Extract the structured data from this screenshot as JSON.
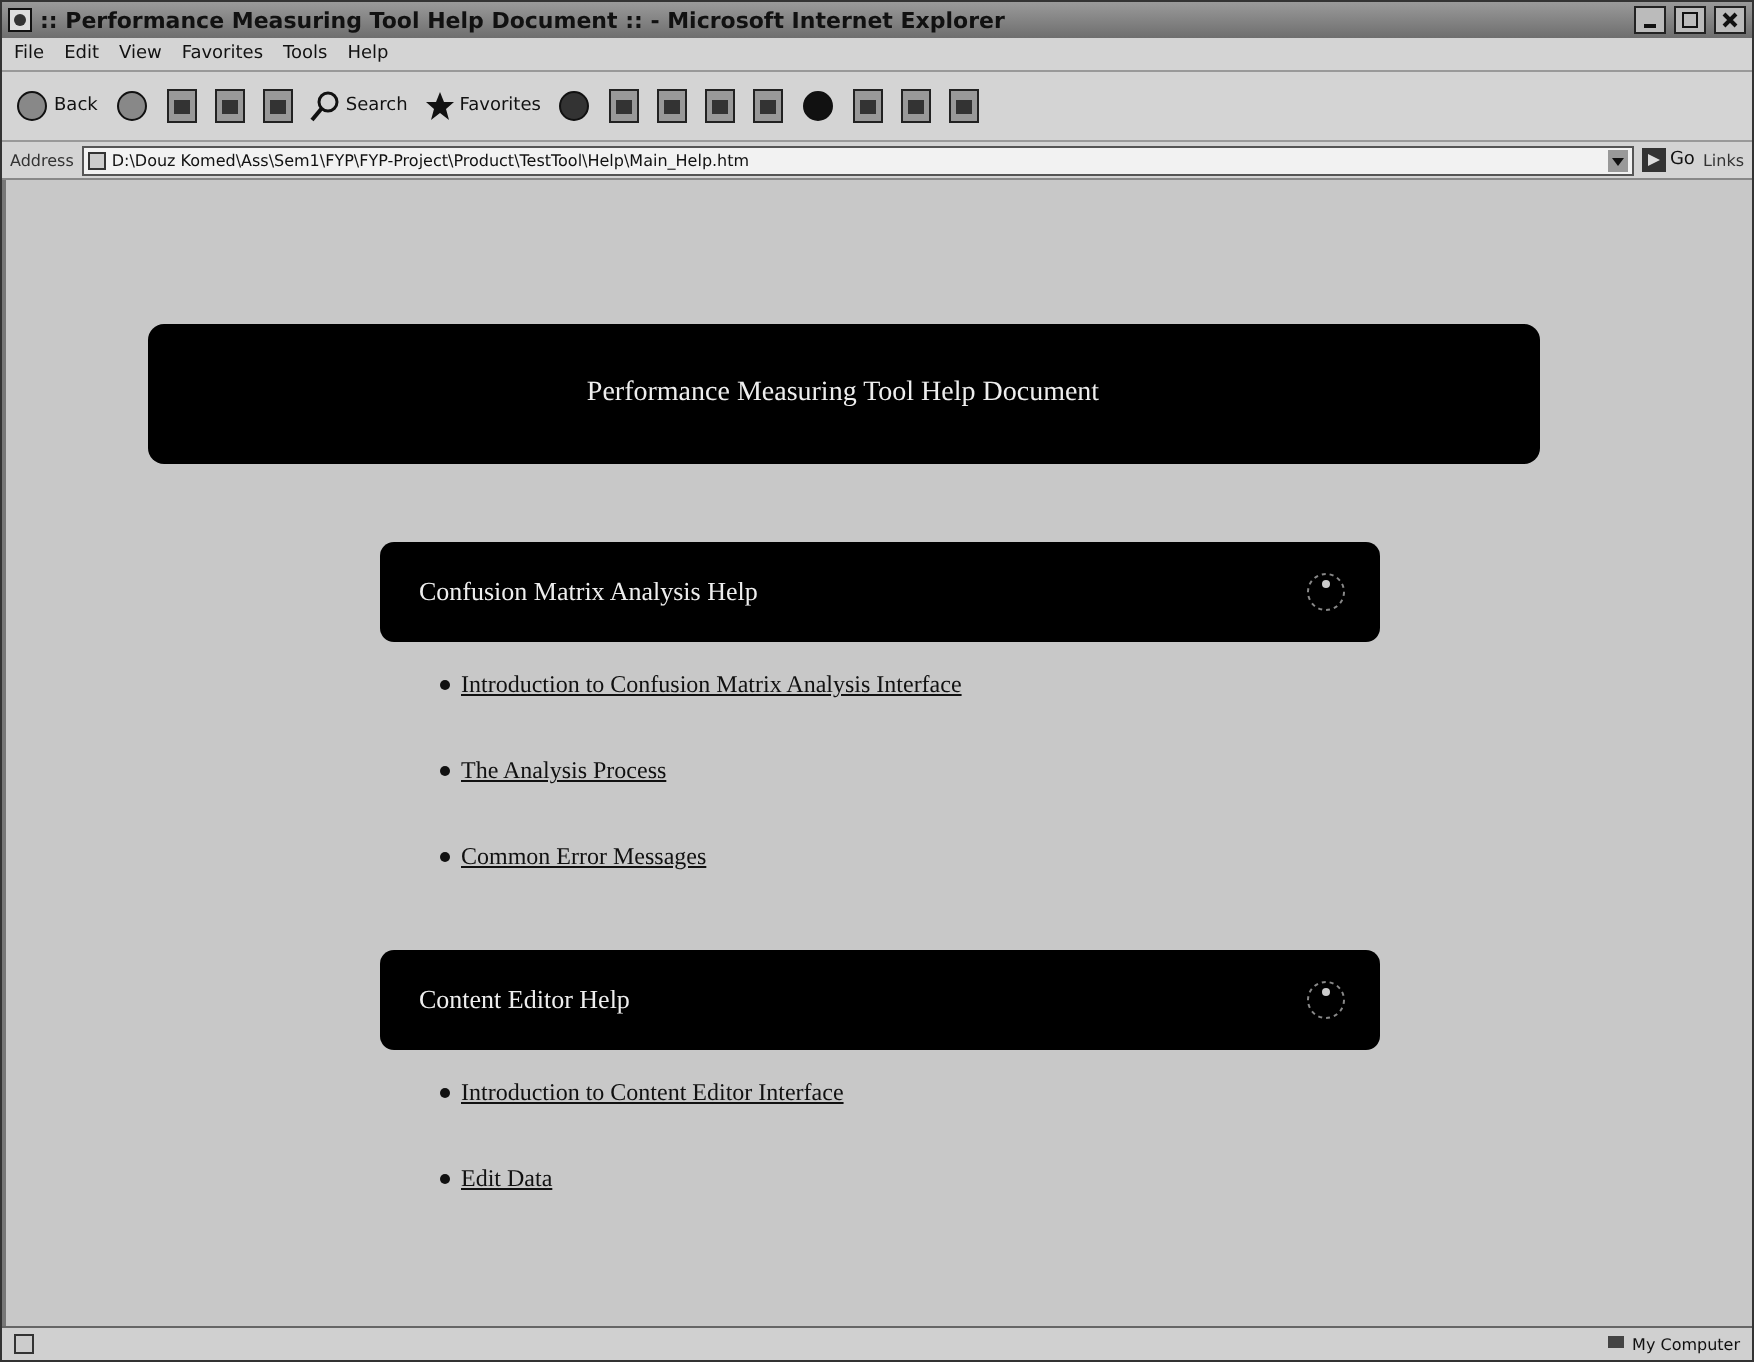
{
  "window": {
    "title": ":: Performance Measuring Tool Help Document :: - Microsoft Internet Explorer"
  },
  "menu": [
    "File",
    "Edit",
    "View",
    "Favorites",
    "Tools",
    "Help"
  ],
  "toolbar": {
    "back": "Back",
    "search": "Search",
    "favorites": "Favorites"
  },
  "address": {
    "label": "Address",
    "value": "D:\\Douz Komed\\Ass\\Sem1\\FYP\\FYP-Project\\Product\\TestTool\\Help\\Main_Help.htm",
    "go": "Go",
    "links": "Links"
  },
  "page": {
    "title": "Performance Measuring Tool Help Document",
    "sections": [
      {
        "title": "Confusion Matrix Analysis Help",
        "links": [
          "Introduction to Confusion Matrix Analysis Interface",
          "The Analysis Process",
          "Common Error Messages"
        ]
      },
      {
        "title": "Content Editor Help",
        "links": [
          "Introduction to Content Editor Interface",
          "Edit Data"
        ]
      }
    ]
  },
  "status_bar": {
    "zone": "My Computer"
  }
}
